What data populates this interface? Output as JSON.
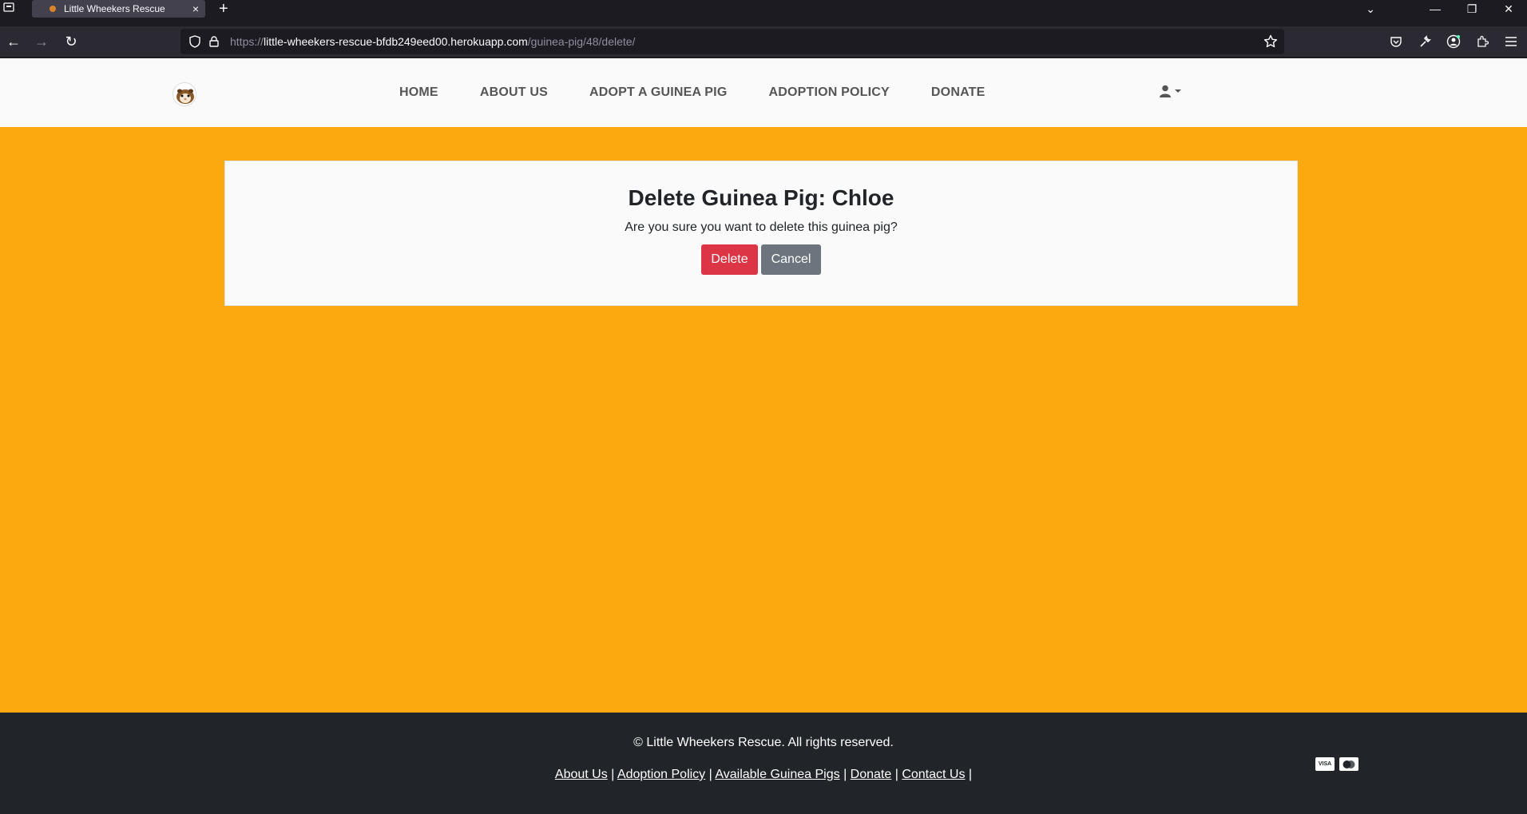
{
  "browser": {
    "tab_title": "Little Wheekers Rescue",
    "tab_close": "×",
    "new_tab": "+",
    "url_proto": "https://",
    "url_host": "little-wheekers-rescue-bfdb249eed00.herokuapp.com",
    "url_path": "/guinea-pig/48/delete/",
    "window_controls": {
      "minimize": "—",
      "restore": "❐",
      "close": "✕"
    },
    "tablist": "⌄",
    "nav": {
      "back": "←",
      "forward": "→",
      "reload": "↻"
    }
  },
  "site": {
    "nav": {
      "home": "HOME",
      "about": "ABOUT US",
      "adopt": "ADOPT A GUINEA PIG",
      "policy": "ADOPTION POLICY",
      "donate": "DONATE"
    },
    "user_icon": "user-icon"
  },
  "main": {
    "heading": "Delete Guinea Pig: Chloe",
    "question": "Are you sure you want to delete this guinea pig?",
    "delete_label": "Delete",
    "cancel_label": "Cancel"
  },
  "footer": {
    "copyright": "© Little Wheekers Rescue. All rights reserved.",
    "links": {
      "about": "About Us",
      "policy": "Adoption Policy",
      "available": "Available Guinea Pigs",
      "donate": "Donate",
      "contact": "Contact Us"
    },
    "separator": "|",
    "payment": {
      "visa": "VISA",
      "mastercard": "MC"
    }
  },
  "colors": {
    "page_bg": "#fba90f",
    "header_bg": "#fafafa",
    "footer_bg": "#212529",
    "delete_btn": "#dc3545",
    "cancel_btn": "#6c757d"
  }
}
